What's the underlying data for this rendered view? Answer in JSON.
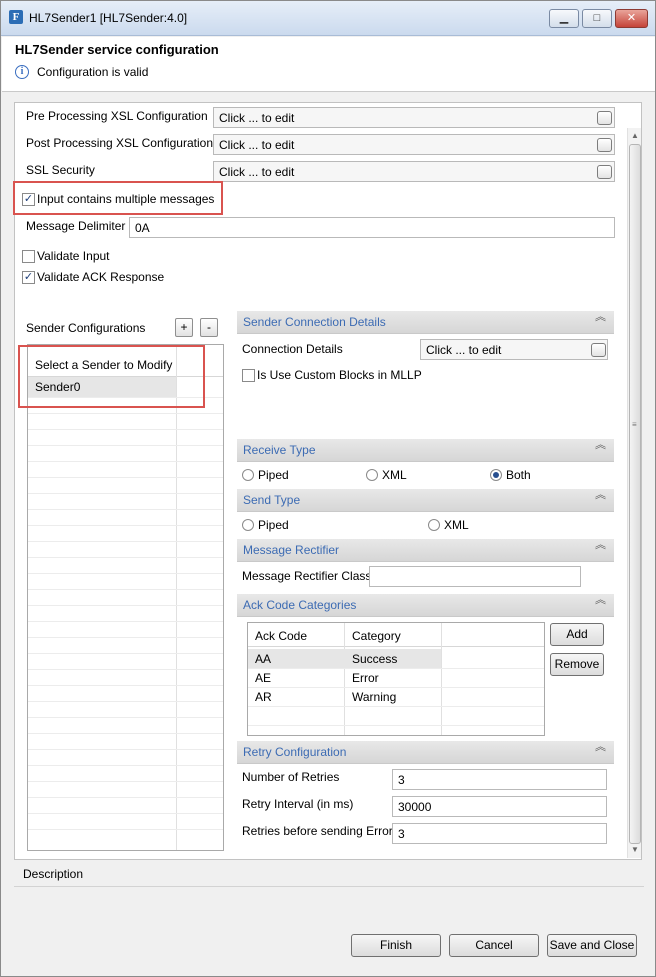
{
  "window": {
    "title": "HL7Sender1 [HL7Sender:4.0]",
    "app_icon_letter": "F",
    "minimize_glyph": "▁",
    "maximize_glyph": "□",
    "close_glyph": "✕"
  },
  "header": {
    "title": "HL7Sender service configuration",
    "status_message": "Configuration is valid",
    "info_glyph": "i"
  },
  "config": {
    "pre_xsl_label": "Pre Processing XSL Configuration",
    "pre_xsl_value": "Click ... to edit",
    "post_xsl_label": "Post Processing XSL Configuration",
    "post_xsl_value": "Click ... to edit",
    "ssl_label": "SSL Security",
    "ssl_value": "Click ... to edit",
    "multiple_messages_label": "Input contains multiple messages",
    "multiple_messages_checked": true,
    "delimiter_label": "Message Delimiter",
    "delimiter_value": "0A",
    "validate_input_label": "Validate Input",
    "validate_input_checked": false,
    "validate_ack_label": "Validate ACK Response",
    "validate_ack_checked": true
  },
  "senders": {
    "label": "Sender Configurations",
    "add_glyph": "+",
    "remove_glyph": "-",
    "column_header": "Select a Sender to Modify",
    "items": [
      "Sender0"
    ]
  },
  "connection": {
    "section_title": "Sender Connection Details",
    "details_label": "Connection Details",
    "details_value": "Click ... to edit",
    "custom_blocks_label": "Is Use Custom Blocks in MLLP",
    "custom_blocks_checked": false
  },
  "receive_type": {
    "section_title": "Receive Type",
    "options": [
      "Piped",
      "XML",
      "Both"
    ],
    "selected": "Both"
  },
  "send_type": {
    "section_title": "Send Type",
    "options": [
      "Piped",
      "XML"
    ],
    "selected": ""
  },
  "rectifier": {
    "section_title": "Message Rectifier",
    "class_label": "Message Rectifier Class",
    "class_value": ""
  },
  "ack": {
    "section_title": "Ack Code Categories",
    "columns": [
      "Ack Code",
      "Category"
    ],
    "rows": [
      [
        "AA",
        "Success"
      ],
      [
        "AE",
        "Error"
      ],
      [
        "AR",
        "Warning"
      ]
    ],
    "add_label": "Add",
    "remove_label": "Remove"
  },
  "retry": {
    "section_title": "Retry Configuration",
    "retries_label": "Number of Retries",
    "retries_value": "3",
    "interval_label": "Retry Interval (in ms)",
    "interval_value": "30000",
    "before_error_label": "Retries before sending Error",
    "before_error_value": "3"
  },
  "description": {
    "label": "Description"
  },
  "footer": {
    "finish_label": "Finish",
    "cancel_label": "Cancel",
    "save_close_label": "Save and Close"
  },
  "icons": {
    "collapse_glyph": "︽",
    "check_glyph": "✓",
    "scroll_up_glyph": "▲",
    "scroll_down_glyph": "▼"
  },
  "colors": {
    "section_title": "#3c6bb3",
    "highlight_box": "#d9534f",
    "selected_row": "#e6e6e6"
  }
}
